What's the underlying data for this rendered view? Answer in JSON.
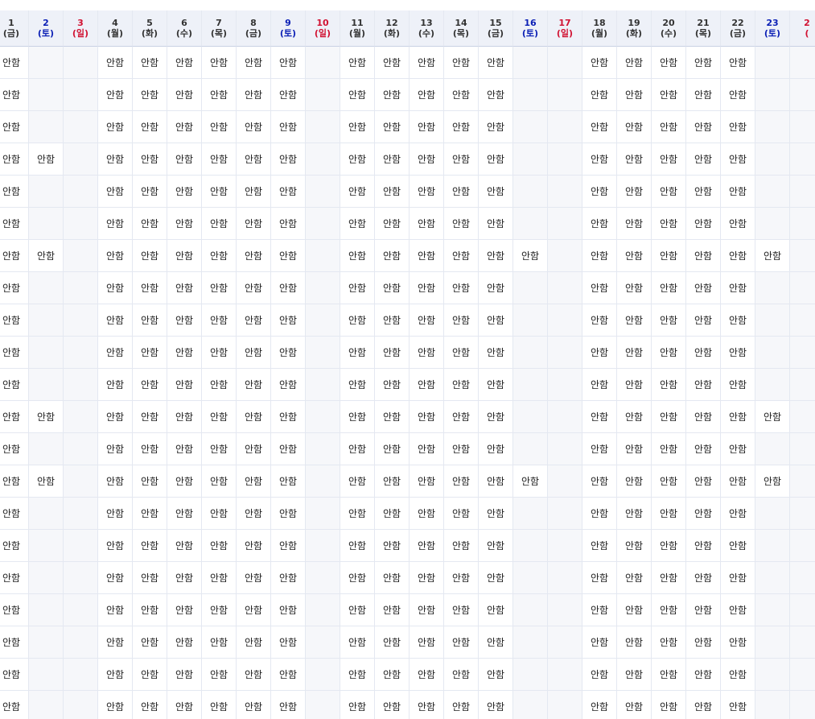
{
  "table": {
    "columns": [
      {
        "day": "1",
        "weekday": "(금)",
        "kind": "weekday"
      },
      {
        "day": "2",
        "weekday": "(토)",
        "kind": "sat"
      },
      {
        "day": "3",
        "weekday": "(일)",
        "kind": "sun"
      },
      {
        "day": "4",
        "weekday": "(월)",
        "kind": "weekday"
      },
      {
        "day": "5",
        "weekday": "(화)",
        "kind": "weekday"
      },
      {
        "day": "6",
        "weekday": "(수)",
        "kind": "weekday"
      },
      {
        "day": "7",
        "weekday": "(목)",
        "kind": "weekday"
      },
      {
        "day": "8",
        "weekday": "(금)",
        "kind": "weekday"
      },
      {
        "day": "9",
        "weekday": "(토)",
        "kind": "sat"
      },
      {
        "day": "10",
        "weekday": "(일)",
        "kind": "sun"
      },
      {
        "day": "11",
        "weekday": "(월)",
        "kind": "weekday"
      },
      {
        "day": "12",
        "weekday": "(화)",
        "kind": "weekday"
      },
      {
        "day": "13",
        "weekday": "(수)",
        "kind": "weekday"
      },
      {
        "day": "14",
        "weekday": "(목)",
        "kind": "weekday"
      },
      {
        "day": "15",
        "weekday": "(금)",
        "kind": "weekday"
      },
      {
        "day": "16",
        "weekday": "(토)",
        "kind": "sat"
      },
      {
        "day": "17",
        "weekday": "(일)",
        "kind": "sun"
      },
      {
        "day": "18",
        "weekday": "(월)",
        "kind": "weekday"
      },
      {
        "day": "19",
        "weekday": "(화)",
        "kind": "weekday"
      },
      {
        "day": "20",
        "weekday": "(수)",
        "kind": "weekday"
      },
      {
        "day": "21",
        "weekday": "(목)",
        "kind": "weekday"
      },
      {
        "day": "22",
        "weekday": "(금)",
        "kind": "weekday"
      },
      {
        "day": "23",
        "weekday": "(토)",
        "kind": "sat"
      },
      {
        "day": "2",
        "weekday": "(",
        "kind": "sun"
      }
    ],
    "mark_text": "안함",
    "rows": [
      [
        1,
        0,
        0,
        1,
        1,
        1,
        1,
        1,
        1,
        0,
        1,
        1,
        1,
        1,
        1,
        0,
        0,
        1,
        1,
        1,
        1,
        1,
        0,
        0
      ],
      [
        1,
        0,
        0,
        1,
        1,
        1,
        1,
        1,
        1,
        0,
        1,
        1,
        1,
        1,
        1,
        0,
        0,
        1,
        1,
        1,
        1,
        1,
        0,
        0
      ],
      [
        1,
        0,
        0,
        1,
        1,
        1,
        1,
        1,
        1,
        0,
        1,
        1,
        1,
        1,
        1,
        0,
        0,
        1,
        1,
        1,
        1,
        1,
        0,
        0
      ],
      [
        1,
        1,
        0,
        1,
        1,
        1,
        1,
        1,
        1,
        0,
        1,
        1,
        1,
        1,
        1,
        0,
        0,
        1,
        1,
        1,
        1,
        1,
        0,
        0
      ],
      [
        1,
        0,
        0,
        1,
        1,
        1,
        1,
        1,
        1,
        0,
        1,
        1,
        1,
        1,
        1,
        0,
        0,
        1,
        1,
        1,
        1,
        1,
        0,
        0
      ],
      [
        1,
        0,
        0,
        1,
        1,
        1,
        1,
        1,
        1,
        0,
        1,
        1,
        1,
        1,
        1,
        0,
        0,
        1,
        1,
        1,
        1,
        1,
        0,
        0
      ],
      [
        1,
        1,
        0,
        1,
        1,
        1,
        1,
        1,
        1,
        0,
        1,
        1,
        1,
        1,
        1,
        1,
        0,
        1,
        1,
        1,
        1,
        1,
        1,
        0
      ],
      [
        1,
        0,
        0,
        1,
        1,
        1,
        1,
        1,
        1,
        0,
        1,
        1,
        1,
        1,
        1,
        0,
        0,
        1,
        1,
        1,
        1,
        1,
        0,
        0
      ],
      [
        1,
        0,
        0,
        1,
        1,
        1,
        1,
        1,
        1,
        0,
        1,
        1,
        1,
        1,
        1,
        0,
        0,
        1,
        1,
        1,
        1,
        1,
        0,
        0
      ],
      [
        1,
        0,
        0,
        1,
        1,
        1,
        1,
        1,
        1,
        0,
        1,
        1,
        1,
        1,
        1,
        0,
        0,
        1,
        1,
        1,
        1,
        1,
        0,
        0
      ],
      [
        1,
        0,
        0,
        1,
        1,
        1,
        1,
        1,
        1,
        0,
        1,
        1,
        1,
        1,
        1,
        0,
        0,
        1,
        1,
        1,
        1,
        1,
        0,
        0
      ],
      [
        1,
        1,
        0,
        1,
        1,
        1,
        1,
        1,
        1,
        0,
        1,
        1,
        1,
        1,
        1,
        0,
        0,
        1,
        1,
        1,
        1,
        1,
        1,
        0
      ],
      [
        1,
        0,
        0,
        1,
        1,
        1,
        1,
        1,
        1,
        0,
        1,
        1,
        1,
        1,
        1,
        0,
        0,
        1,
        1,
        1,
        1,
        1,
        0,
        0
      ],
      [
        1,
        1,
        0,
        1,
        1,
        1,
        1,
        1,
        1,
        0,
        1,
        1,
        1,
        1,
        1,
        1,
        0,
        1,
        1,
        1,
        1,
        1,
        1,
        0
      ],
      [
        1,
        0,
        0,
        1,
        1,
        1,
        1,
        1,
        1,
        0,
        1,
        1,
        1,
        1,
        1,
        0,
        0,
        1,
        1,
        1,
        1,
        1,
        0,
        0
      ],
      [
        1,
        0,
        0,
        1,
        1,
        1,
        1,
        1,
        1,
        0,
        1,
        1,
        1,
        1,
        1,
        0,
        0,
        1,
        1,
        1,
        1,
        1,
        0,
        0
      ],
      [
        1,
        0,
        0,
        1,
        1,
        1,
        1,
        1,
        1,
        0,
        1,
        1,
        1,
        1,
        1,
        0,
        0,
        1,
        1,
        1,
        1,
        1,
        0,
        0
      ],
      [
        1,
        0,
        0,
        1,
        1,
        1,
        1,
        1,
        1,
        0,
        1,
        1,
        1,
        1,
        1,
        0,
        0,
        1,
        1,
        1,
        1,
        1,
        0,
        0
      ],
      [
        1,
        0,
        0,
        1,
        1,
        1,
        1,
        1,
        1,
        0,
        1,
        1,
        1,
        1,
        1,
        0,
        0,
        1,
        1,
        1,
        1,
        1,
        0,
        0
      ],
      [
        1,
        0,
        0,
        1,
        1,
        1,
        1,
        1,
        1,
        0,
        1,
        1,
        1,
        1,
        1,
        0,
        0,
        1,
        1,
        1,
        1,
        1,
        0,
        0
      ],
      [
        1,
        0,
        0,
        1,
        1,
        1,
        1,
        1,
        1,
        0,
        1,
        1,
        1,
        1,
        1,
        0,
        0,
        1,
        1,
        1,
        1,
        1,
        0,
        0
      ]
    ]
  }
}
